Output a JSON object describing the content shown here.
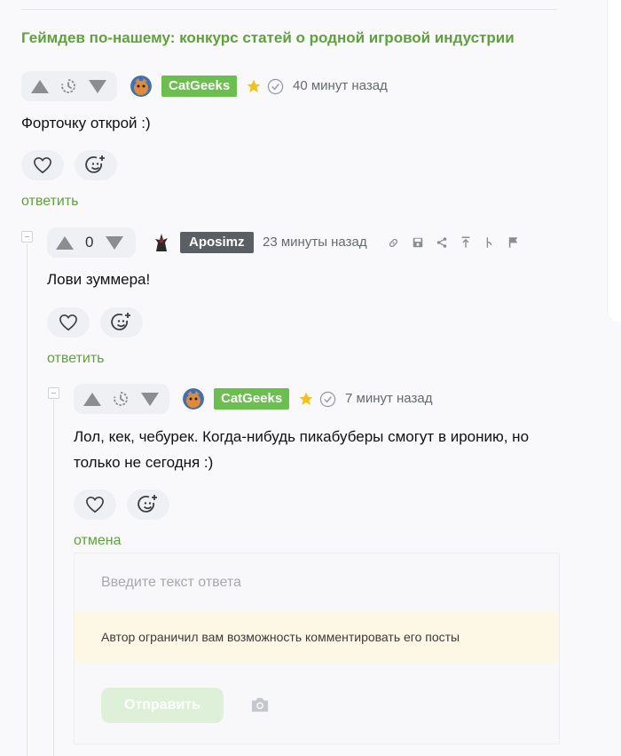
{
  "post": {
    "title": "Геймдев по-нашему: конкурс статей о родной игровой индустрии"
  },
  "colors": {
    "accent": "#5da33a",
    "nick_green": "#6bbf4e",
    "nick_gray": "#5a5f66",
    "star": "#f5c30f"
  },
  "comments": [
    {
      "author": "CatGeeks",
      "time": "40 минут назад",
      "text": "Форточку открой :)",
      "action": "ответить",
      "icons": [
        "arrow-up-icon",
        "clock-icon",
        "arrow-down-icon",
        "star-icon",
        "verified-icon",
        "heart-icon",
        "smile-plus-icon"
      ]
    },
    {
      "author": "Aposimz",
      "rating": "0",
      "time": "23 минуты назад",
      "text": "Лови зуммера!",
      "action": "ответить",
      "icons": [
        "link-icon",
        "save-icon",
        "share-icon",
        "to-top-icon",
        "branch-icon",
        "flag-icon"
      ]
    },
    {
      "author": "CatGeeks",
      "time": "7 минут назад",
      "text_line1": "Лол, кек, чебурек. Когда-нибудь пикабуберы смогут в иронию, но",
      "text_line2": "только не сегодня :)",
      "action": "отмена"
    }
  ],
  "reply_form": {
    "placeholder": "Введите текст ответа",
    "notice": "Автор ограничил вам возможность комментировать его посты",
    "send_label": "Отправить",
    "camera_icon": "camera-icon"
  }
}
